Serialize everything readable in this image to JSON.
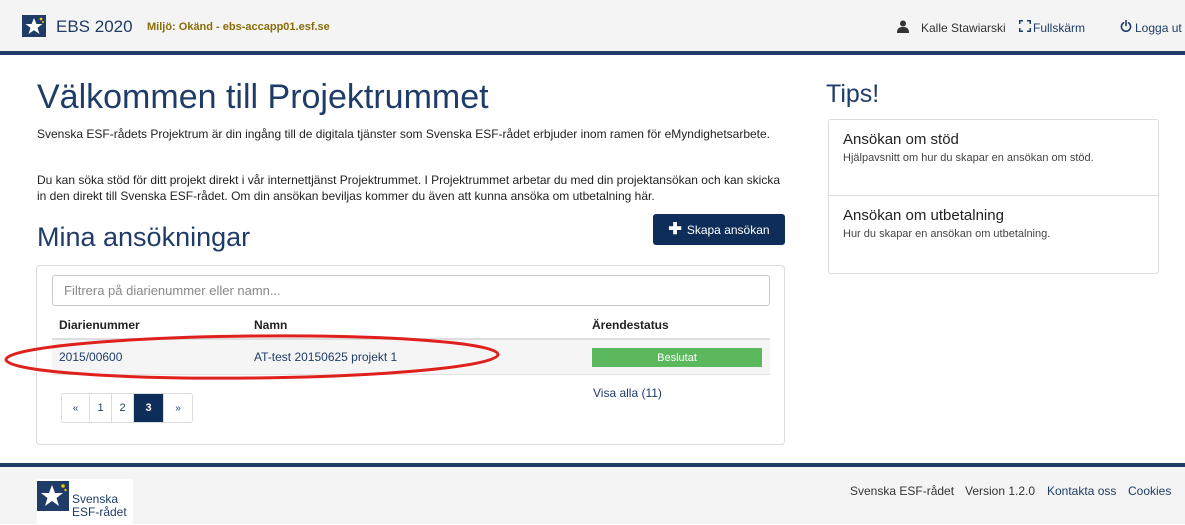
{
  "header": {
    "app_title": "EBS 2020",
    "environment": "Miljö: Okänd - ebs-accapp01.esf.se",
    "user_name": "Kalle Stawiarski",
    "fullscreen_label": "Fullskärm",
    "logout_label": "Logga ut"
  },
  "main": {
    "title": "Välkommen till Projektrummet",
    "intro_1": "Svenska ESF-rådets Projektrum är din ingång till de digitala tjänster som Svenska ESF-rådet erbjuder inom ramen för eMyndighetsarbete.",
    "intro_2": "Du kan söka stöd för ditt projekt direkt i vår internettjänst Projektrummet. I Projektrummet arbetar du med din projektansökan och kan skicka in den direkt till Svenska ESF-rådet. Om din ansökan beviljas kommer du även att kunna ansöka om utbetalning här."
  },
  "applications": {
    "title": "Mina ansökningar",
    "create_button": "Skapa ansökan",
    "filter_placeholder": "Filtrera på diarienummer eller namn...",
    "columns": {
      "diarienummer": "Diarienummer",
      "namn": "Namn",
      "status": "Ärendestatus"
    },
    "rows": [
      {
        "diarienummer": "2015/00600",
        "namn": "AT-test 20150625 projekt 1",
        "status": "Beslutat",
        "status_color": "#5cb85c"
      }
    ],
    "pagination": {
      "prev": "«",
      "pages": [
        "1",
        "2",
        "3"
      ],
      "current_page": "3",
      "next": "»"
    },
    "show_all": "Visa alla (11)"
  },
  "tips": {
    "title": "Tips!",
    "items": [
      {
        "title": "Ansökan om stöd",
        "description": "Hjälpavsnitt om hur du skapar en ansökan om stöd."
      },
      {
        "title": "Ansökan om utbetalning",
        "description": "Hur du skapar en ansökan om utbetalning."
      }
    ]
  },
  "footer": {
    "logo_text_line1": "Svenska",
    "logo_text_line2": "ESF-rådet",
    "organization": "Svenska ESF-rådet",
    "version": "Version 1.2.0",
    "contact": "Kontakta oss",
    "cookies": "Cookies"
  },
  "colors": {
    "brand_navy": "#1f3c68",
    "button_navy": "#0f2d59",
    "status_green": "#5cb85c",
    "environment_text": "#8a6d0b",
    "annotation_red": "#e0201c"
  },
  "icons": {
    "brand": "esf-star-logo-icon",
    "user": "user-icon",
    "fullscreen": "fullscreen-icon",
    "logout": "power-icon",
    "create": "plus-icon"
  }
}
